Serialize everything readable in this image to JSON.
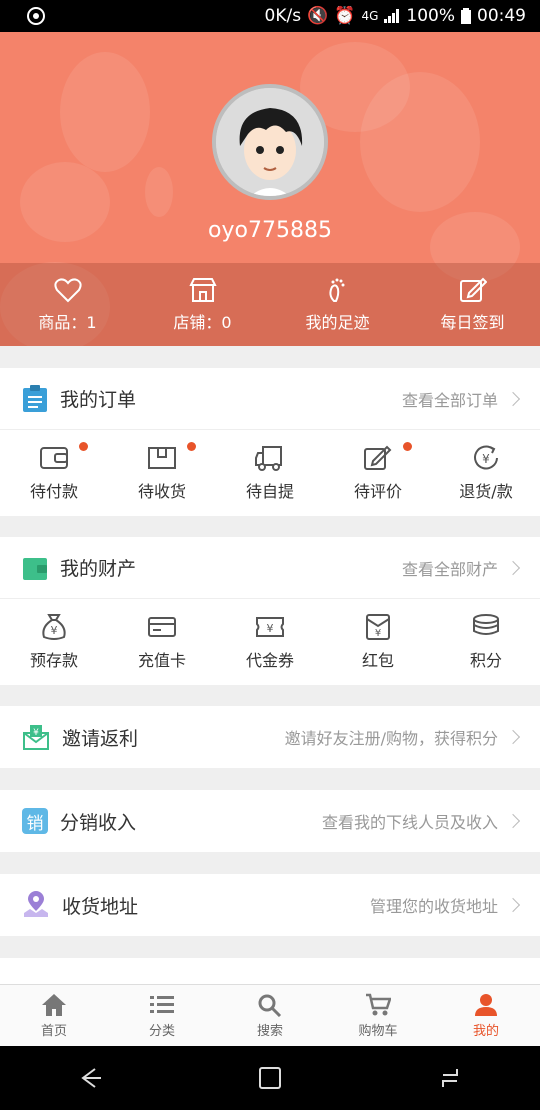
{
  "status_bar": {
    "net_speed": "0K/s",
    "network": "4G",
    "battery": "100%",
    "time": "00:49"
  },
  "profile": {
    "username": "oyo775885"
  },
  "stats": [
    {
      "label": "商品：1",
      "icon": "heart-icon"
    },
    {
      "label": "店铺：0",
      "icon": "store-icon"
    },
    {
      "label": "我的足迹",
      "icon": "footprint-icon"
    },
    {
      "label": "每日签到",
      "icon": "edit-icon"
    }
  ],
  "orders": {
    "title": "我的订单",
    "more": "查看全部订单",
    "items": [
      {
        "label": "待付款",
        "badge": true
      },
      {
        "label": "待收货",
        "badge": true
      },
      {
        "label": "待自提",
        "badge": false
      },
      {
        "label": "待评价",
        "badge": true
      },
      {
        "label": "退货/款",
        "badge": false
      }
    ]
  },
  "assets": {
    "title": "我的财产",
    "more": "查看全部财产",
    "items": [
      {
        "label": "预存款"
      },
      {
        "label": "充值卡"
      },
      {
        "label": "代金券"
      },
      {
        "label": "红包"
      },
      {
        "label": "积分"
      }
    ]
  },
  "invite": {
    "title": "邀请返利",
    "more": "邀请好友注册/购物，获得积分"
  },
  "distribution": {
    "title": "分销收入",
    "more": "查看我的下线人员及收入",
    "icon_text": "销"
  },
  "address": {
    "title": "收货地址",
    "more": "管理您的收货地址"
  },
  "tabs": [
    {
      "label": "首页",
      "active": false
    },
    {
      "label": "分类",
      "active": false
    },
    {
      "label": "搜索",
      "active": false
    },
    {
      "label": "购物车",
      "active": false
    },
    {
      "label": "我的",
      "active": true
    }
  ],
  "colors": {
    "header": "#f4836a",
    "accent": "#e8542a",
    "orders_icon": "#3a9fd8",
    "assets_icon": "#3dbf8a",
    "invite_icon": "#3dbf8a",
    "distribution_icon": "#5fb8e6",
    "address_icon": "#9b7fd6"
  }
}
